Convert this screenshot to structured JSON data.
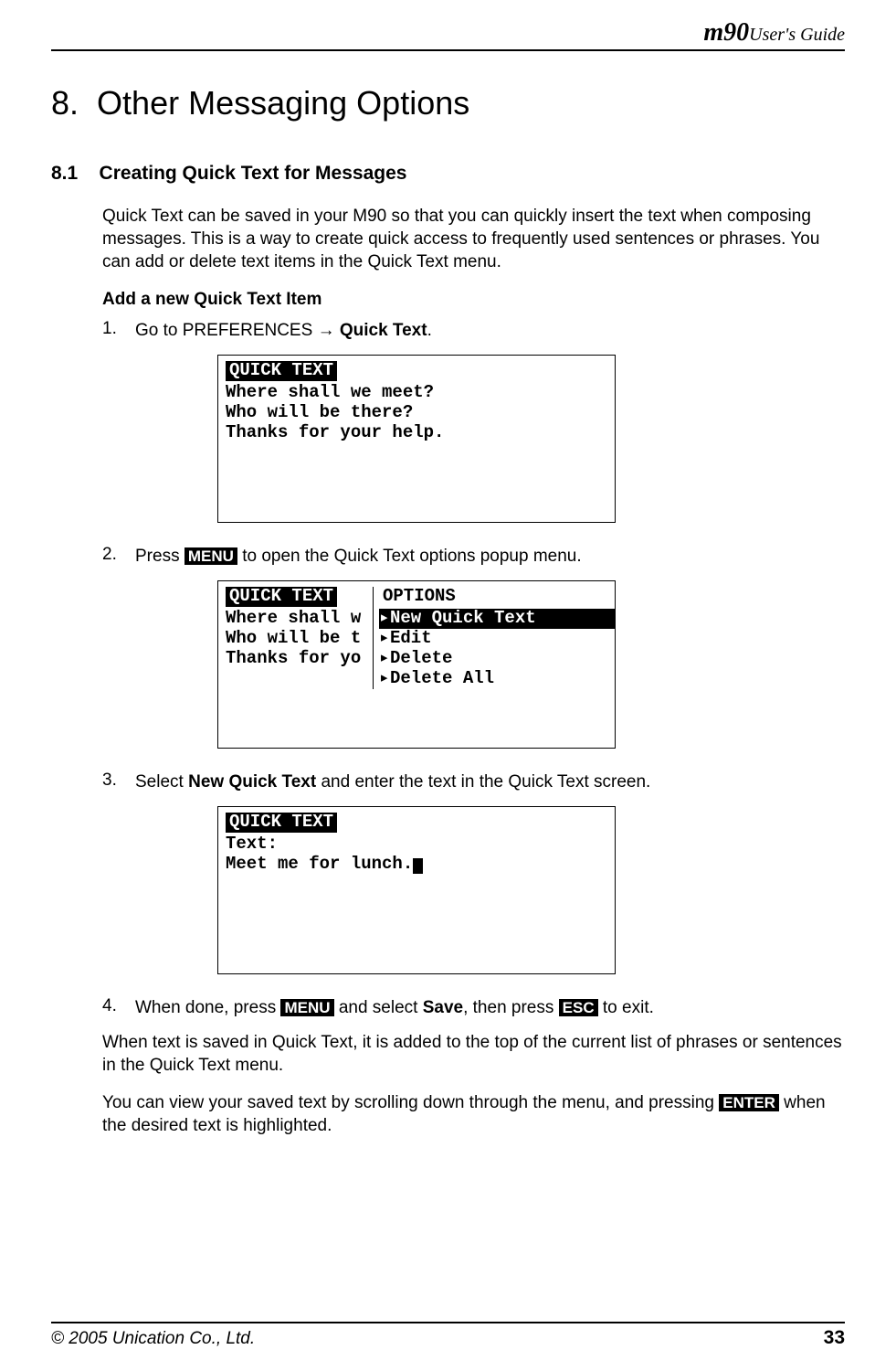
{
  "header": {
    "logo": "m90",
    "guide": "User's Guide"
  },
  "chapter": {
    "num": "8.",
    "title": "Other Messaging Options"
  },
  "section": {
    "num": "8.1",
    "title": "Creating Quick Text for Messages"
  },
  "intro": "Quick Text can be saved in your M90 so that you can quickly insert the text when composing messages. This is a way to create quick access to frequently used sentences or phrases. You can add or delete text items in the Quick Text menu.",
  "subhead": "Add a new Quick Text Item",
  "steps": {
    "s1": {
      "num": "1.",
      "pre": "Go to PREFERENCES ",
      "arrow": "→",
      "post": " ",
      "bold": "Quick Text",
      "tail": "."
    },
    "s2": {
      "num": "2.",
      "pre": "Press ",
      "key": "MENU",
      "post": " to open the Quick Text options popup menu."
    },
    "s3": {
      "num": "3.",
      "pre": "Select ",
      "bold": "New Quick Text",
      "post": " and enter the text in the Quick Text screen."
    },
    "s4": {
      "num": "4.",
      "pre": "When done, press ",
      "key1": "MENU",
      "mid1": " and select ",
      "bold": "Save",
      "mid2": ", then press ",
      "key2": "ESC",
      "post": " to exit."
    }
  },
  "screens": {
    "s1": {
      "title": " QUICK TEXT ",
      "lines": [
        "Where shall we meet?",
        "Who will be there?",
        "Thanks for your help."
      ]
    },
    "s2": {
      "left_title": " QUICK TEXT ",
      "left_lines": [
        "Where shall w",
        "Who will be t",
        "Thanks for yo"
      ],
      "right_title": " OPTIONS",
      "options": [
        {
          "label": "New Quick Text",
          "selected": true
        },
        {
          "label": "Edit",
          "selected": false
        },
        {
          "label": "Delete",
          "selected": false
        },
        {
          "label": "Delete All",
          "selected": false
        }
      ]
    },
    "s3": {
      "title": " QUICK TEXT ",
      "label": "Text:",
      "value": "Meet me for lunch."
    }
  },
  "after": {
    "p1": "When text is saved in Quick Text, it is added to the top of the current list of phrases or sentences in the Quick Text menu.",
    "p2_pre": "You can view your saved text by scrolling down through the menu, and pressing ",
    "p2_key": "ENTER",
    "p2_post": " when the desired text is highlighted."
  },
  "footer": {
    "copyright": "© 2005 Unication Co., Ltd.",
    "page": "33"
  }
}
